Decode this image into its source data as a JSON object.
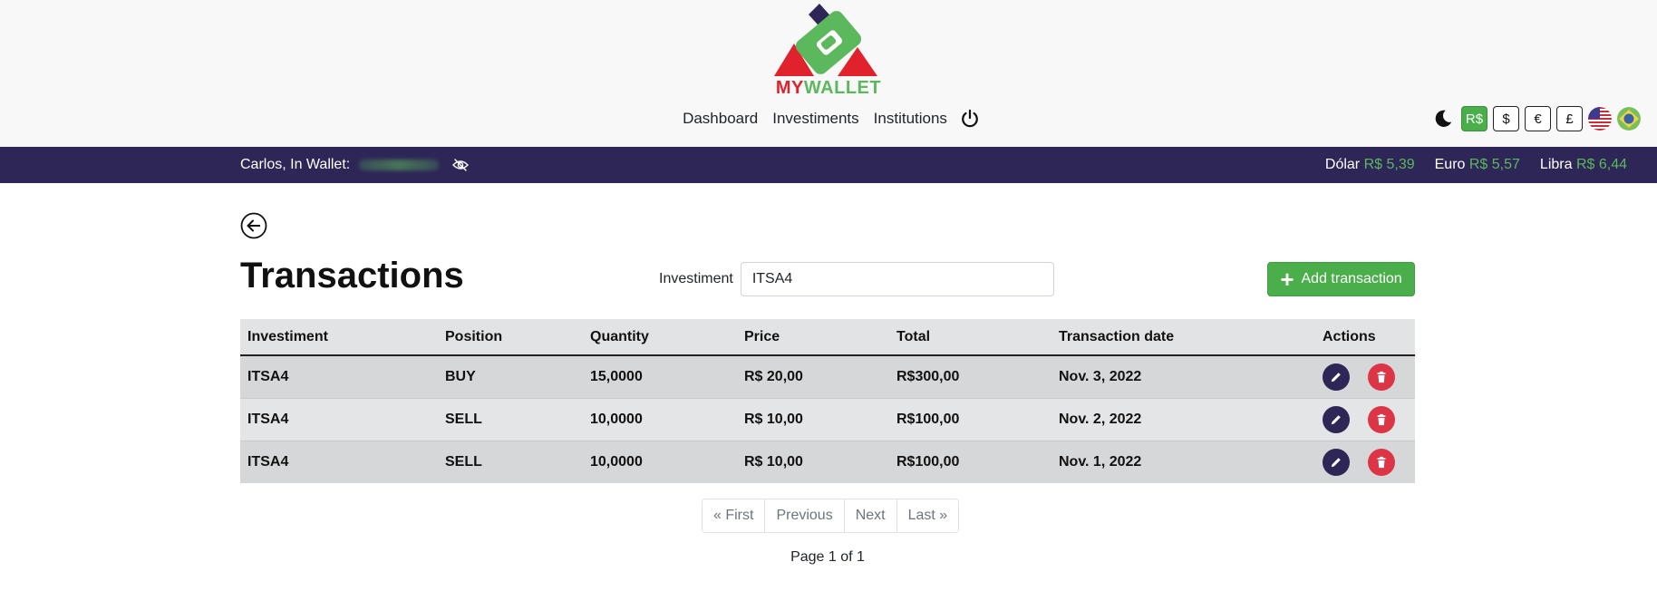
{
  "brand": {
    "logo_my": "MY",
    "logo_wallet": "WALLET"
  },
  "nav": {
    "dashboard": "Dashboard",
    "investments": "Investiments",
    "institutions": "Institutions",
    "power_icon": "power-icon"
  },
  "toolbar": {
    "theme_icon": "moon-icon",
    "currencies": [
      "R$",
      "$",
      "€",
      "£"
    ],
    "active_currency": "R$",
    "flags": [
      "us-flag-icon",
      "brazil-flag-icon"
    ]
  },
  "status_bar": {
    "greeting": "Carlos, In Wallet:",
    "rates": [
      {
        "label": "Dólar",
        "value": "R$ 5,39"
      },
      {
        "label": "Euro",
        "value": "R$ 5,57"
      },
      {
        "label": "Libra",
        "value": "R$ 6,44"
      }
    ]
  },
  "page": {
    "title": "Transactions",
    "filter_label": "Investiment",
    "filter_value": "ITSA4",
    "add_button": "Add transaction"
  },
  "table": {
    "headers": [
      "Investiment",
      "Position",
      "Quantity",
      "Price",
      "Total",
      "Transaction date",
      "Actions"
    ],
    "rows": [
      [
        "ITSA4",
        "BUY",
        "15,0000",
        "R$ 20,00",
        "R$300,00",
        "Nov. 3, 2022"
      ],
      [
        "ITSA4",
        "SELL",
        "10,0000",
        "R$ 10,00",
        "R$100,00",
        "Nov. 2, 2022"
      ],
      [
        "ITSA4",
        "SELL",
        "10,0000",
        "R$ 10,00",
        "R$100,00",
        "Nov. 1, 2022"
      ]
    ]
  },
  "pagination": {
    "first": "« First",
    "previous": "Previous",
    "next": "Next",
    "last": "Last »",
    "info": "Page 1 of 1"
  },
  "colors": {
    "primary": "#2e2657",
    "accent": "#5cb85c",
    "danger": "#dc3545",
    "brand_red": "#e0222c"
  }
}
